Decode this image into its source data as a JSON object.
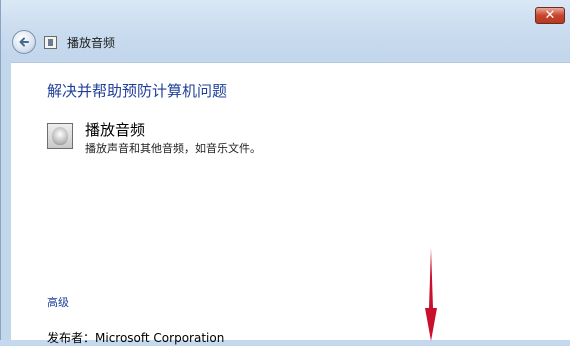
{
  "window": {
    "title": "播放音频",
    "close_label": "✕"
  },
  "content": {
    "heading": "解决并帮助预防计算机问题",
    "item": {
      "title": "播放音频",
      "description": "播放声音和其他音频，如音乐文件。",
      "icon": "speaker-icon"
    },
    "advanced_link": "高级",
    "publisher": "发布者：Microsoft Corporation"
  },
  "colors": {
    "heading": "#1f3f99",
    "close_button": "#c7442d",
    "annotation_arrow": "#c8102e"
  }
}
